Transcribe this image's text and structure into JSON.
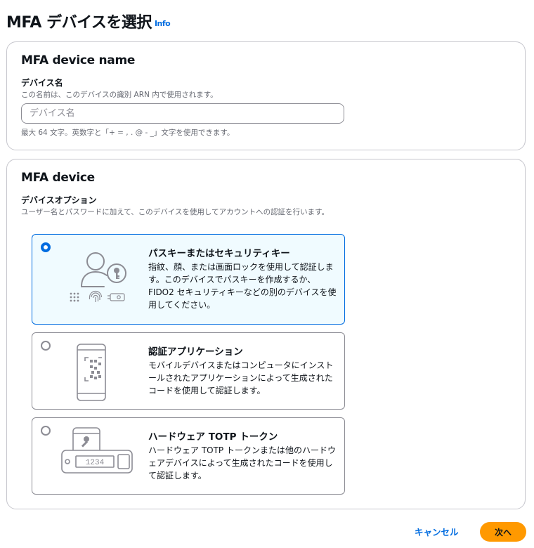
{
  "page": {
    "title": "MFA デバイスを選択",
    "info_link": "Info"
  },
  "device_name_section": {
    "title": "MFA device name",
    "field_label": "デバイス名",
    "field_description": "この名前は、このデバイスの識別 ARN 内で使用されます。",
    "input_value": "",
    "input_placeholder": "デバイス名",
    "constraint_text": "最大 64 文字。英数字と「+ = , . @ - _」文字を使用できます。"
  },
  "device_section": {
    "title": "MFA device",
    "field_label": "デバイスオプション",
    "field_description": "ユーザー名とパスワードに加えて、このデバイスを使用してアカウントへの認証を行います。",
    "options": [
      {
        "title": "パスキーまたはセキュリティキー",
        "description": "指紋、顔、または画面ロックを使用して認証します。このデバイスでパスキーを作成するか、FIDO2 セキュリティキーなどの別のデバイスを使用してください。",
        "icon": "passkey-icon",
        "selected": true
      },
      {
        "title": "認証アプリケーション",
        "description": "モバイルデバイスまたはコンピュータにインストールされたアプリケーションによって生成されたコードを使用して認証します。",
        "icon": "authenticator-app-icon",
        "selected": false
      },
      {
        "title": "ハードウェア TOTP トークン",
        "description": "ハードウェア TOTP トークンまたは他のハードウェアデバイスによって生成されたコードを使用して認証します。",
        "icon": "hardware-token-icon",
        "token_display": "1234",
        "selected": false
      }
    ]
  },
  "footer": {
    "cancel_label": "キャンセル",
    "next_label": "次へ"
  },
  "colors": {
    "accent": "#006ce0",
    "primary_button": "#ff9900",
    "selected_background": "#f0fbff"
  }
}
